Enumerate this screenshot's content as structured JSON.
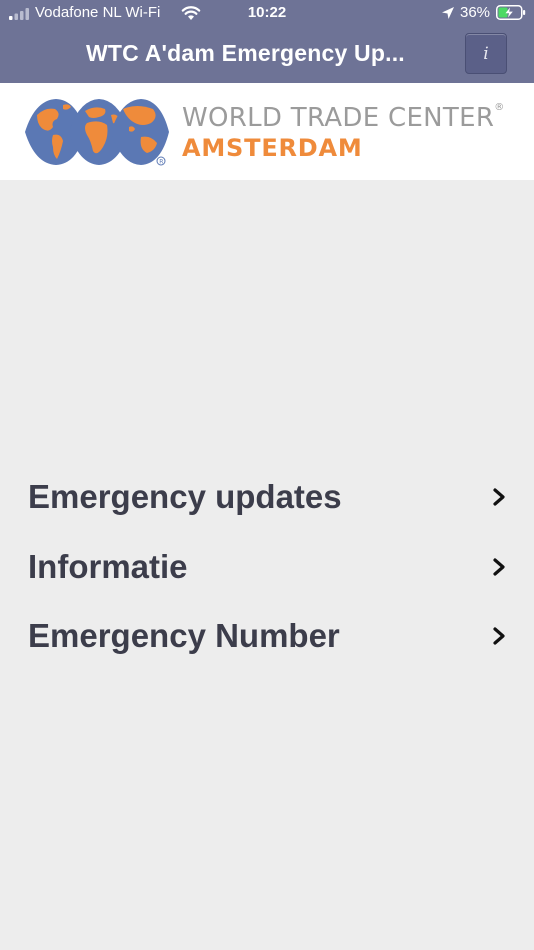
{
  "status_bar": {
    "carrier": "Vodafone NL Wi-Fi",
    "time": "10:22",
    "battery_percent": "36%",
    "signal_icon": "signal-bars-icon",
    "wifi_icon": "wifi-icon",
    "location_icon": "location-arrow-icon",
    "battery_icon": "battery-charging-icon"
  },
  "nav": {
    "title": "WTC A'dam Emergency Up...",
    "info_label": "i"
  },
  "logo": {
    "line1": "WORLD TRADE CENTER",
    "registered": "®",
    "line2": "AMSTERDAM",
    "colors": {
      "grey": "#9b9b9b",
      "orange": "#ef8b3b",
      "blue": "#5b78b4"
    }
  },
  "menu": {
    "items": [
      {
        "label": "Emergency updates"
      },
      {
        "label": "Informatie"
      },
      {
        "label": "Emergency Number"
      }
    ]
  },
  "colors": {
    "nav_background": "#6e7396",
    "page_background": "#ededed",
    "menu_text": "#3c3d4b"
  }
}
